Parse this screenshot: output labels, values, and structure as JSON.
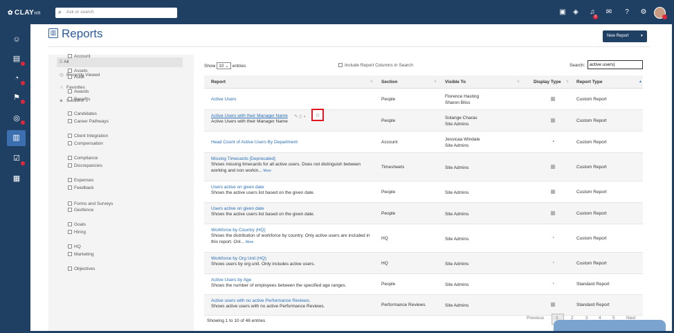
{
  "app": {
    "logo": "CLAY",
    "logo_suffix": "HR",
    "search_placeholder": "Ask or search"
  },
  "topbar": {
    "icons": [
      "calendar-check-icon",
      "layers-icon",
      "bell-icon",
      "mail-icon",
      "help-icon",
      "gear-icon"
    ],
    "bell_badge": "3"
  },
  "sidebar": {
    "icons": [
      "people-icon",
      "timesheet-icon",
      "analytics-icon",
      "goals-icon",
      "compliance-icon",
      "reports-icon",
      "tasks-icon",
      "clipboard-icon"
    ]
  },
  "page": {
    "title": "Reports",
    "new_report": "New Report"
  },
  "filters": {
    "all": "All",
    "recent": "Recently Viewed",
    "favorites": "Favorites",
    "sections_label": "Sections",
    "sections": [
      "Account",
      "Assets",
      "Audit",
      "Awards",
      "Benefits",
      "Candidates",
      "Career Pathways",
      "Client Integration",
      "Compensation",
      "Compliance",
      "Discrepancies",
      "Expenses",
      "Feedback",
      "Forms and Surveys",
      "Geofence",
      "Goals",
      "Hiring",
      "HQ",
      "Marketing",
      "Objectives"
    ]
  },
  "controls": {
    "show_label": "Show",
    "page_size": "10",
    "entries_label": "entries",
    "include_columns": "Include Report Columns in Search",
    "search_label": "Search:",
    "search_value": "active users"
  },
  "table": {
    "headers": [
      "Report",
      "Section",
      "Visible To",
      "Display Type",
      "Report Type"
    ],
    "rows": [
      {
        "name": "Active Users",
        "desc": "",
        "more": "",
        "section": "People",
        "visible": [
          "Florence Hasting",
          "Sharon Bliss"
        ],
        "display_icon": "table-icon",
        "type": "Custom Report"
      },
      {
        "name": "Active Users with their Manager Name",
        "desc": "Active Users with their Manager Name",
        "more": "",
        "section": "People",
        "visible": [
          "Solange Charas",
          "Site Admins"
        ],
        "display_icon": "table-icon",
        "type": "Custom Report"
      },
      {
        "name": "Head Count of Active Users By Department",
        "desc": "",
        "more": "",
        "section": "Account",
        "visible": [
          "Jessicaa Windale",
          "Site Admins"
        ],
        "display_icon": "pie-chart-icon",
        "type": "Custom Report"
      },
      {
        "name": "Missing Timecards [Deprecated]",
        "desc": "Shows missing timecards for all active users. Does not distinguish between working and non workin...",
        "more": "More",
        "section": "Timesheets",
        "visible": [
          "Site Admins"
        ],
        "display_icon": "table-icon",
        "type": "Custom Report"
      },
      {
        "name": "Users active on given date",
        "desc": "Shows the active users list based on the given date.",
        "more": "",
        "section": "People",
        "visible": [
          "Site Admins"
        ],
        "display_icon": "table-icon",
        "type": "Custom Report"
      },
      {
        "name": "Users active on given date",
        "desc": "Shows the active users list based on the given date.",
        "more": "",
        "section": "People",
        "visible": [
          "Site Admins"
        ],
        "display_icon": "table-icon",
        "type": "Custom Report"
      },
      {
        "name": "Workforce by Country (HQ)",
        "desc": "Shows the distribution of workforce by country. Only active users are included in this report. Onl...",
        "more": "More",
        "section": "HQ",
        "visible": [
          "Site Admins"
        ],
        "display_icon": "pie-chart-icon",
        "type": "Custom Report"
      },
      {
        "name": "Workforce by Org Unit (HQ)",
        "desc": "Shows users by org unit. Only includes active users.",
        "more": "",
        "section": "HQ",
        "visible": [
          "Site Admins"
        ],
        "display_icon": "pie-chart-icon",
        "type": "Custom Report"
      },
      {
        "name": "Active Users by Age",
        "desc": "Shows the number of employees between the specified age ranges.",
        "more": "",
        "section": "People",
        "visible": [
          "Site Admins"
        ],
        "display_icon": "pie-chart-icon",
        "type": "Standard Report"
      },
      {
        "name": "Active users with no active Performance Reviews.",
        "desc": "Shows active users with no active Performance Reviews.",
        "more": "",
        "section": "Performance Reviews",
        "visible": [
          "Site Admins"
        ],
        "display_icon": "table-icon",
        "type": "Standard Report"
      }
    ]
  },
  "footer": {
    "info": "Showing 1 to 10 of 48 entries",
    "previous": "Previous",
    "pages": [
      "1",
      "2",
      "3",
      "4",
      "5"
    ],
    "next": "Next"
  },
  "colors": {
    "navy": "#1f3f63",
    "link": "#2a6fb7",
    "highlight": "#e3141f",
    "badge": "#e0283a"
  }
}
